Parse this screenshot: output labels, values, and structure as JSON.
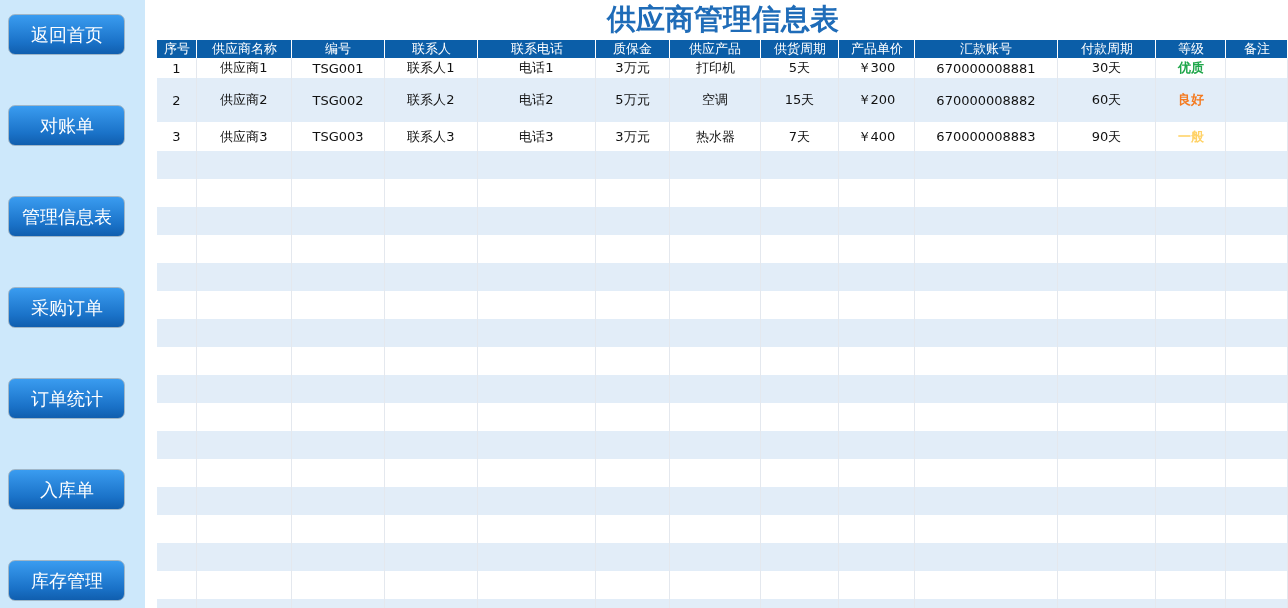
{
  "sidebar": {
    "buttons": [
      "返回首页",
      "对账单",
      "管理信息表",
      "采购订单",
      "订单统计",
      "入库单",
      "库存管理"
    ]
  },
  "title": "供应商管理信息表",
  "table": {
    "columns": [
      "序号",
      "供应商名称",
      "编号",
      "联系人",
      "联系电话",
      "质保金",
      "供应产品",
      "供货周期",
      "产品单价",
      "汇款账号",
      "付款周期",
      "等级",
      "备注"
    ],
    "rows": [
      {
        "cells": [
          "1",
          "供应商1",
          "TSG001",
          "联系人1",
          "电话1",
          "3万元",
          "打印机",
          "5天",
          "￥300",
          "670000008881",
          "30天"
        ],
        "grade": {
          "text": "优质",
          "color": "#1fa64a"
        }
      },
      {
        "cells": [
          "2",
          "供应商2",
          "TSG002",
          "联系人2",
          "电话2",
          "5万元",
          "空调",
          "15天",
          "￥200",
          "670000008882",
          "60天"
        ],
        "grade": {
          "text": "良好",
          "color": "#f47a20"
        }
      },
      {
        "cells": [
          "3",
          "供应商3",
          "TSG003",
          "联系人3",
          "电话3",
          "3万元",
          "热水器",
          "7天",
          "￥400",
          "670000008883",
          "90天"
        ],
        "grade": {
          "text": "一般",
          "color": "#ffd266"
        }
      }
    ]
  }
}
